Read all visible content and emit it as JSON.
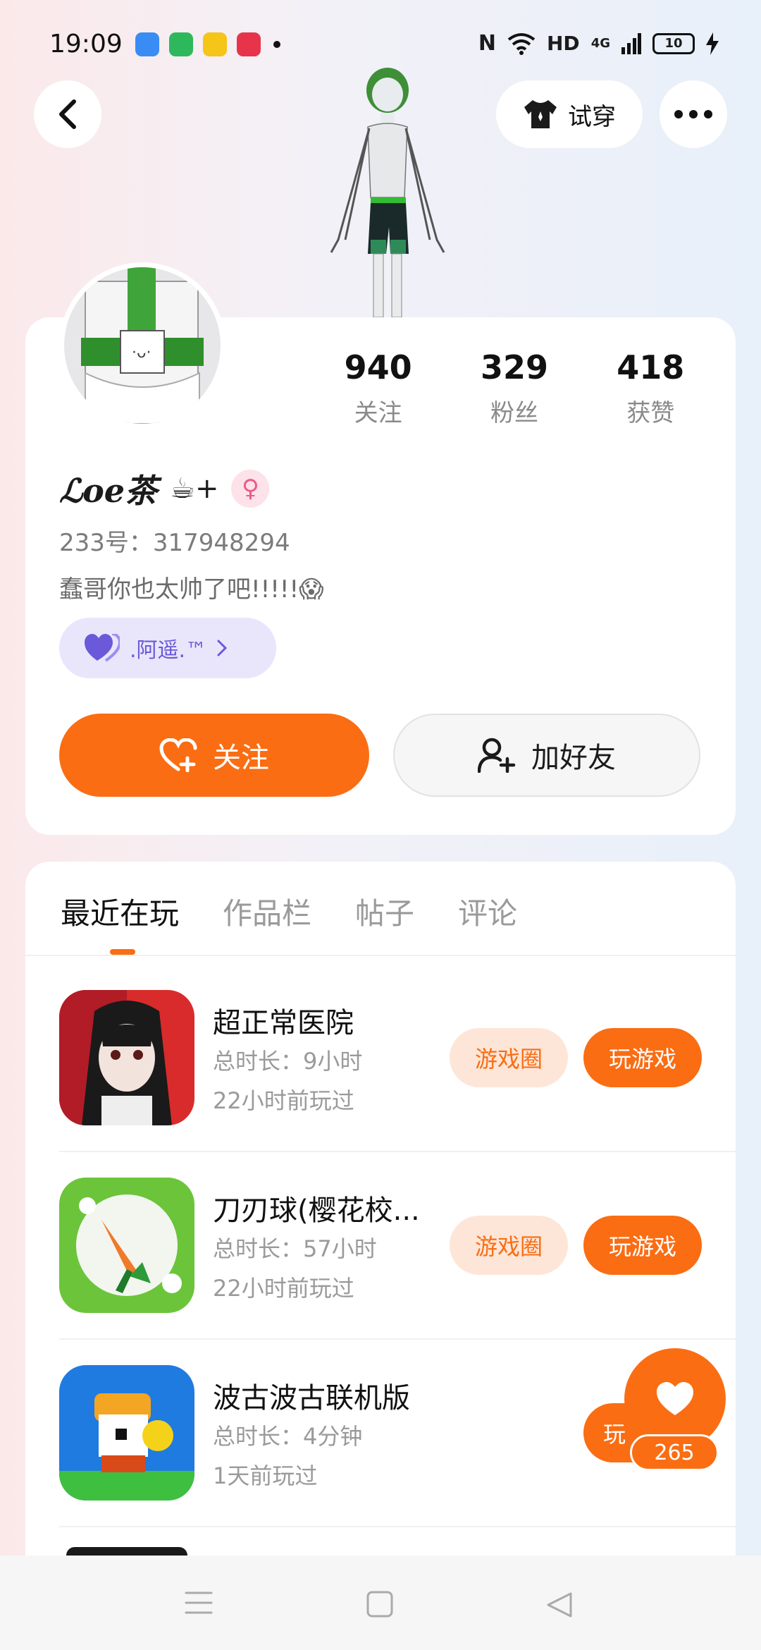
{
  "status_bar": {
    "time": "19:09",
    "network": "HD",
    "signal": "4G",
    "battery": "10"
  },
  "header": {
    "try_on_label": "试穿"
  },
  "profile": {
    "username": "ℒoe茶",
    "badge_text": "☕+",
    "stats": [
      {
        "value": "940",
        "label": "关注"
      },
      {
        "value": "329",
        "label": "粉丝"
      },
      {
        "value": "418",
        "label": "获赞"
      }
    ],
    "id_line": "233号：317948294",
    "bio": "蠢哥你也太帅了吧!!!!!😱",
    "intimacy_chip": ".阿遥.™",
    "follow_label": "关注",
    "add_friend_label": "加好友"
  },
  "tabs": [
    "最近在玩",
    "作品栏",
    "帖子",
    "评论"
  ],
  "games": [
    {
      "title": "超正常医院",
      "time": "总时长：9小时",
      "last": "22小时前玩过",
      "circle": "游戏圈",
      "play": "玩游戏"
    },
    {
      "title": "刀刃球(樱花校...",
      "time": "总时长：57小时",
      "last": "22小时前玩过",
      "circle": "游戏圈",
      "play": "玩游戏"
    },
    {
      "title": "波古波古联机版",
      "time": "总时长：4分钟",
      "last": "1天前玩过",
      "circle": "",
      "play": "玩"
    }
  ],
  "fab": {
    "count": "265"
  }
}
